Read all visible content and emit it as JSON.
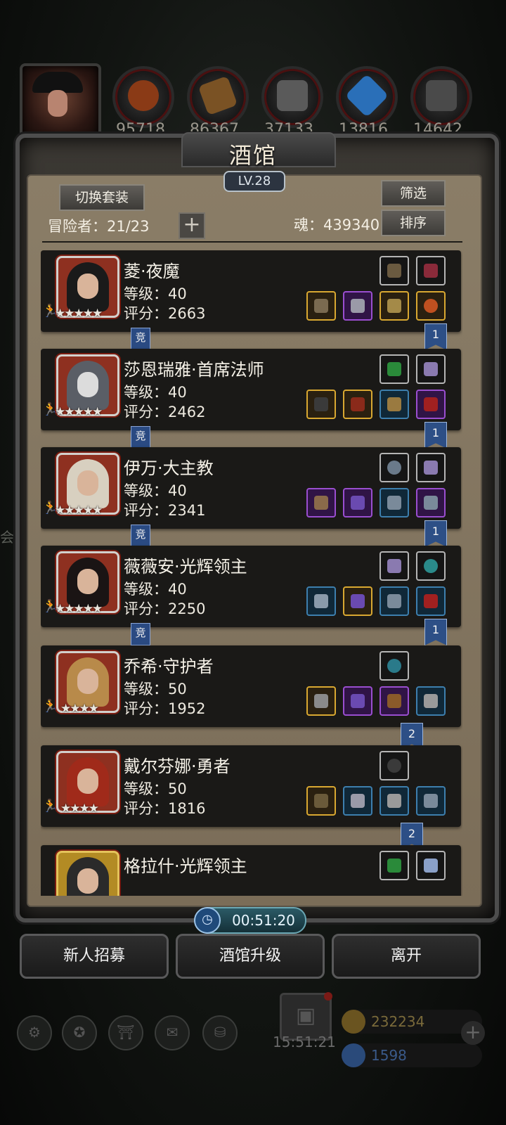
{
  "resources": {
    "values": [
      "95718",
      "86367",
      "37133",
      "13816",
      "14642"
    ],
    "icons": [
      "meat-icon",
      "wood-icon",
      "iron-icon",
      "crystal-icon",
      "stone-icon"
    ]
  },
  "panel": {
    "title": "酒馆",
    "level": "LV.28",
    "switch_outfit": "切换套装",
    "filter": "筛选",
    "sort": "排序",
    "adventurers": "冒险者：21/23",
    "soul": "魂：439340"
  },
  "heroes": [
    {
      "name": "菱·夜魔",
      "level": "等级：40",
      "score": "评分：2663",
      "stars": "★★★★★",
      "comp": "竞",
      "team": "1",
      "top_eq": [
        "gray",
        "gray"
      ],
      "bottom_eq": [
        "gold",
        "purple",
        "gold",
        "gold"
      ]
    },
    {
      "name": "莎恩瑞雅·首席法师",
      "level": "等级：40",
      "score": "评分：2462",
      "stars": "★★★★★",
      "comp": "竞",
      "team": "1",
      "top_eq": [
        "gray",
        "gray"
      ],
      "bottom_eq": [
        "gold",
        "gold",
        "blue",
        "purple"
      ]
    },
    {
      "name": "伊万·大主教",
      "level": "等级：40",
      "score": "评分：2341",
      "stars": "★★★★★",
      "comp": "竞",
      "team": "1",
      "top_eq": [
        "gray",
        "gray"
      ],
      "bottom_eq": [
        "purple",
        "purple",
        "blue",
        "purple"
      ]
    },
    {
      "name": "薇薇安·光辉领主",
      "level": "等级：40",
      "score": "评分：2250",
      "stars": "★★★★★",
      "comp": "竞",
      "team": "1",
      "top_eq": [
        "gray",
        "gray"
      ],
      "bottom_eq": [
        "blue",
        "gold",
        "blue",
        "blue"
      ]
    },
    {
      "name": "乔希·守护者",
      "level": "等级：50",
      "score": "评分：1952",
      "stars": "★★★★",
      "comp": "",
      "team": "2",
      "top_eq": [
        "gray"
      ],
      "bottom_eq": [
        "gold",
        "purple",
        "purple",
        "blue"
      ]
    },
    {
      "name": "戴尔芬娜·勇者",
      "level": "等级：50",
      "score": "评分：1816",
      "stars": "★★★★",
      "comp": "",
      "team": "2",
      "top_eq": [
        "gray"
      ],
      "bottom_eq": [
        "gold",
        "blue",
        "blue",
        "blue"
      ]
    },
    {
      "name": "格拉什·光辉领主",
      "level": "",
      "score": "",
      "stars": "",
      "comp": "",
      "team": "",
      "top_eq": [
        "gray",
        "gray"
      ],
      "bottom_eq": []
    }
  ],
  "timer": "00:51:20",
  "actions": {
    "recruit": "新人招募",
    "upgrade": "酒馆升级",
    "leave": "离开"
  },
  "background": {
    "gift_timer": "15:51:21",
    "gold": "232234",
    "gems": "1598",
    "side_text": "会"
  }
}
